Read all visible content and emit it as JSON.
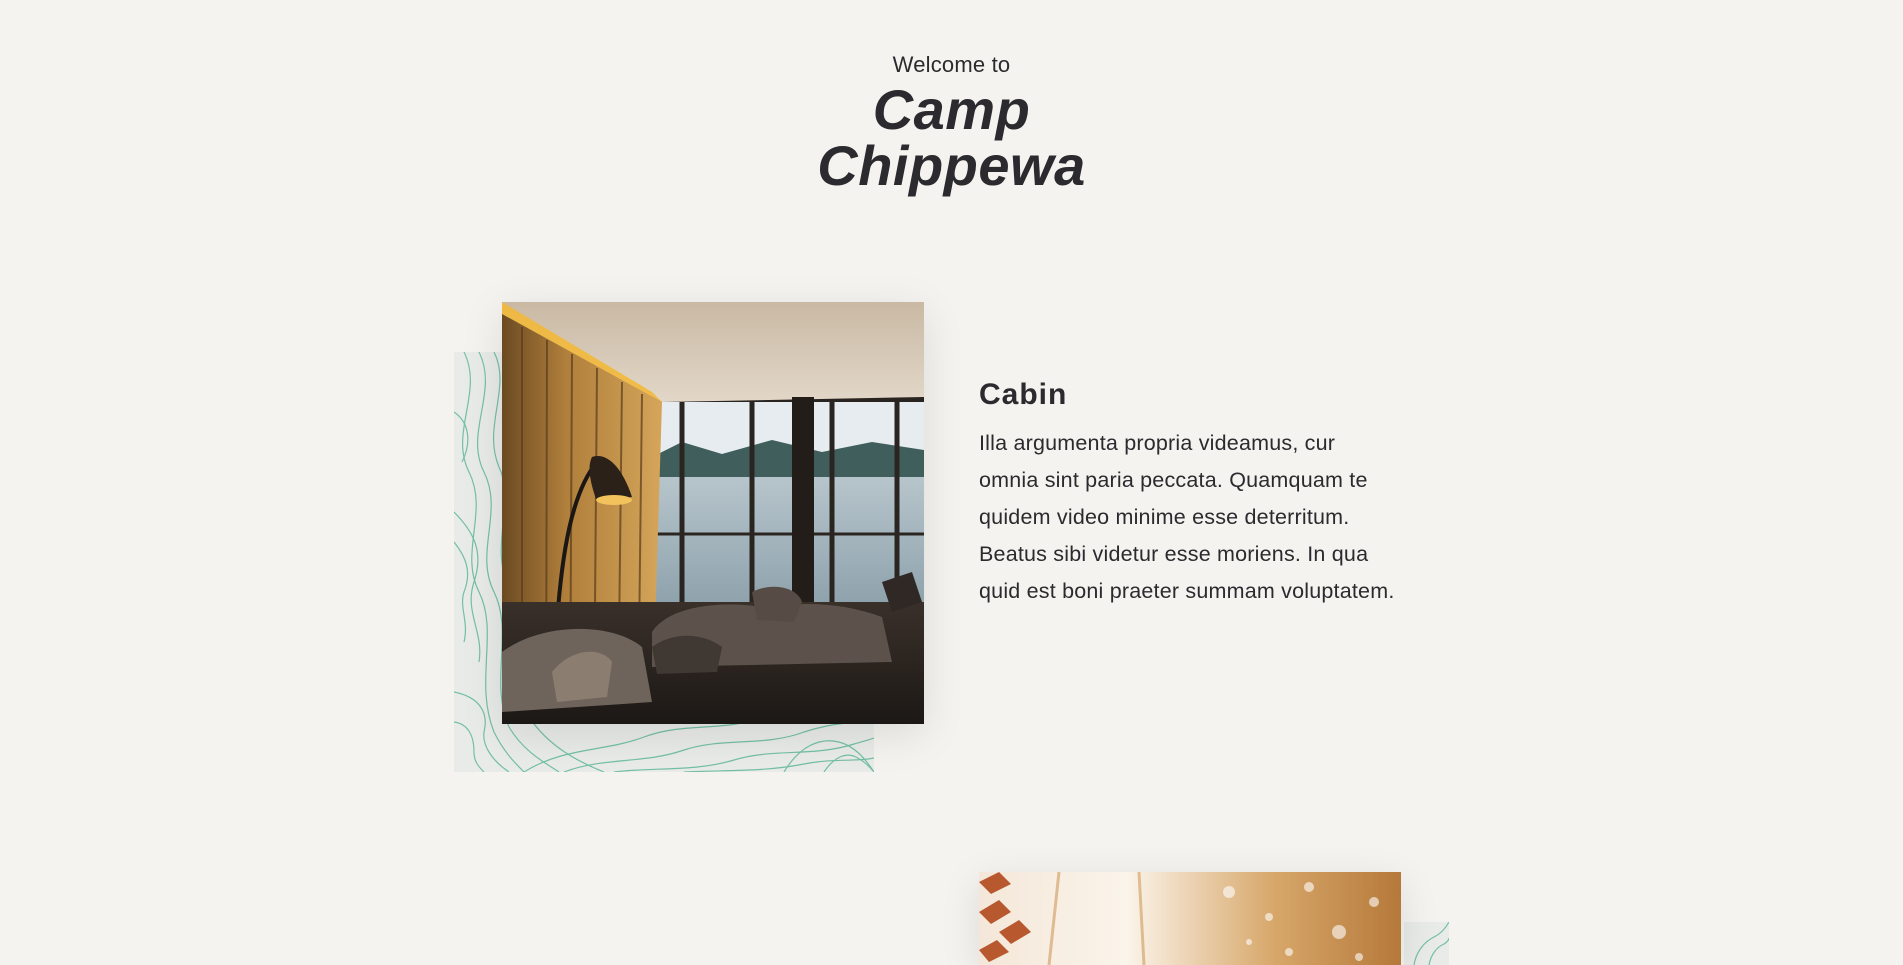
{
  "hero": {
    "welcome": "Welcome to",
    "title_line1": "Camp",
    "title_line2": "Chippewa"
  },
  "sections": [
    {
      "heading": "Cabin",
      "body": "Illa argumenta propria videamus, cur omnia sint paria peccata. Quamquam te quidem video minime esse deterritum. Beatus sibi videtur esse moriens. In qua quid est boni praeter summam voluptatem."
    }
  ],
  "colors": {
    "background": "#f5f3ef",
    "text": "#2b2a2e",
    "topo_line": "#5fb89a",
    "topo_bg": "#e9ebe8"
  },
  "icons": {
    "topo_pattern": "topographic-lines",
    "cabin_photo": "cabin-interior-lake-view",
    "second_photo": "warm-bokeh-photo"
  }
}
